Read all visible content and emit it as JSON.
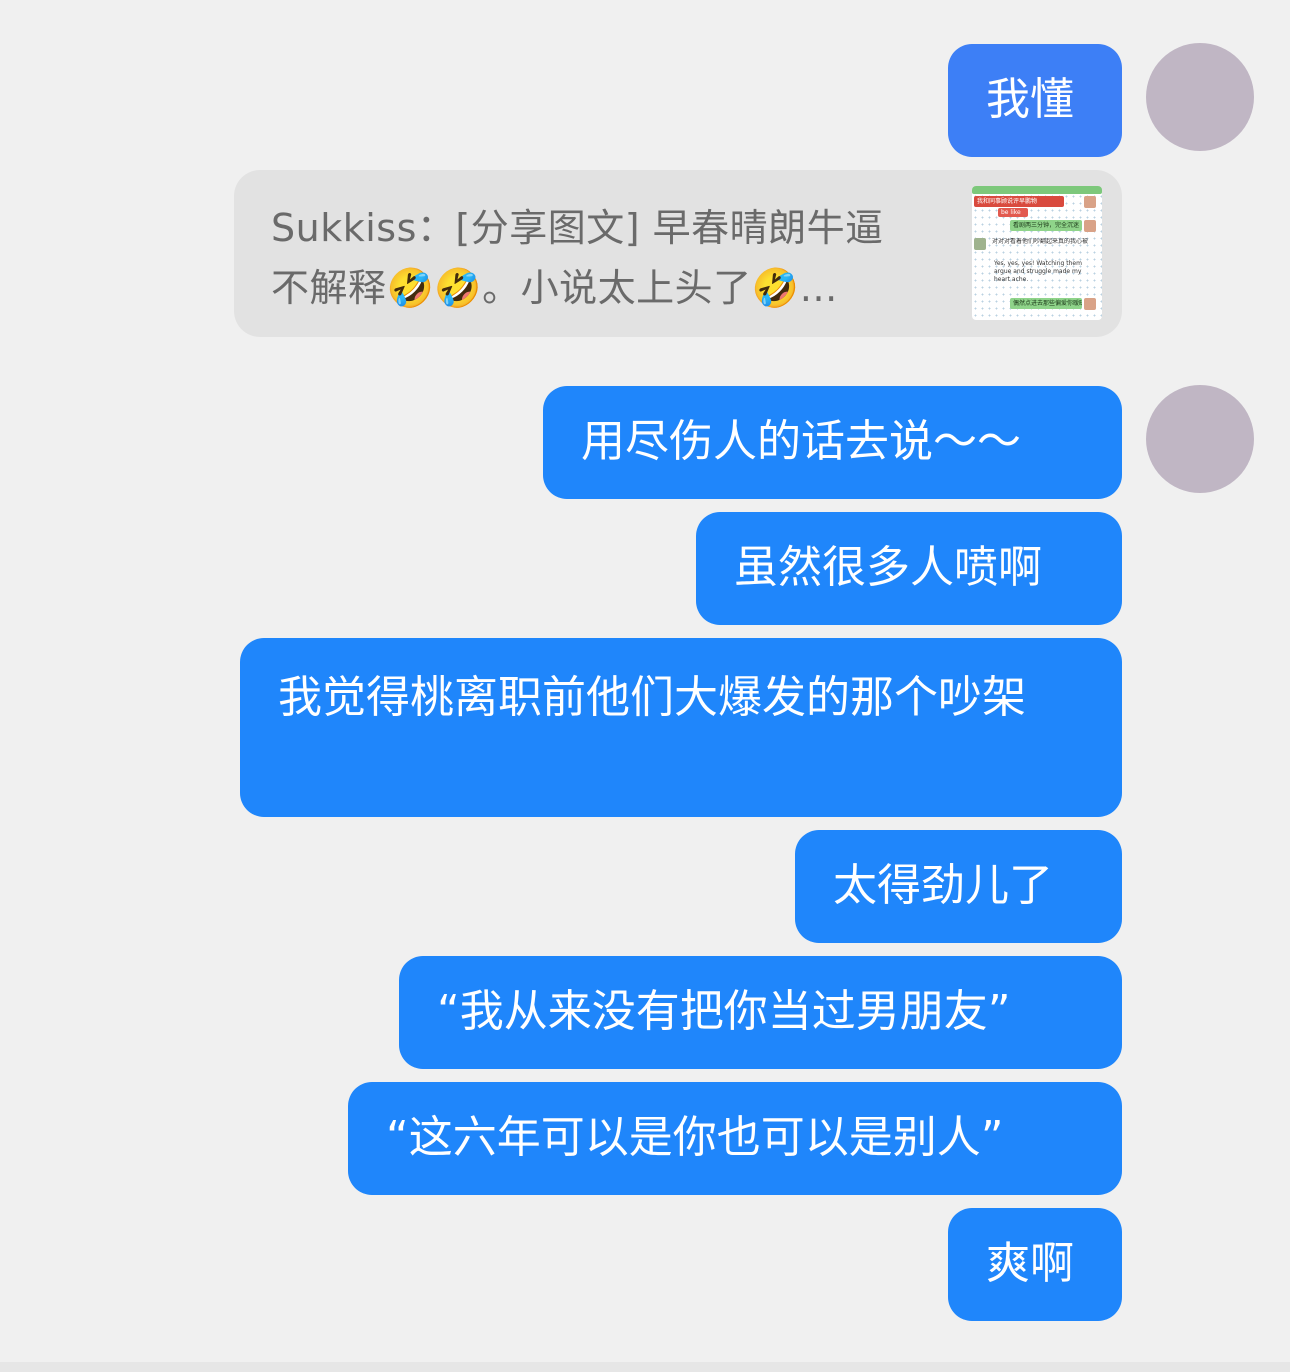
{
  "messages": [
    {
      "text": "我懂"
    },
    {
      "text": "用尽伤人的话去说～～"
    },
    {
      "text": "虽然很多人喷啊"
    },
    {
      "text": "我觉得桃离职前他们大爆发的那个吵架"
    },
    {
      "text": "太得劲儿了"
    },
    {
      "text": "“我从来没有把你当过男朋友”"
    },
    {
      "text": "“这六年可以是你也可以是别人”"
    },
    {
      "text": "爽啊"
    }
  ],
  "quote": {
    "sender": "Sukkiss",
    "line1": "Sukkiss：[分享图文] 早春晴朗牛逼",
    "line2": "不解释🤣🤣。小说太上头了🤣…",
    "thumbnail": {
      "header": "我和同事顾说评早鹏物",
      "tag": "be like",
      "bubble1": "看剧两三分钟，完全沉迷",
      "body1": "对对对看着他们吵翻起来真的我心被",
      "body2": "Yes, yes, yes! Watching them argue and struggle made my heart ache.",
      "footer": "偶然点进去那些偏爱你暧昧"
    }
  },
  "colors": {
    "background": "#f0f0f0",
    "bubble": "#1f86fb",
    "quote_bg": "#e2e2e2",
    "avatar": "#c0b6c4"
  }
}
